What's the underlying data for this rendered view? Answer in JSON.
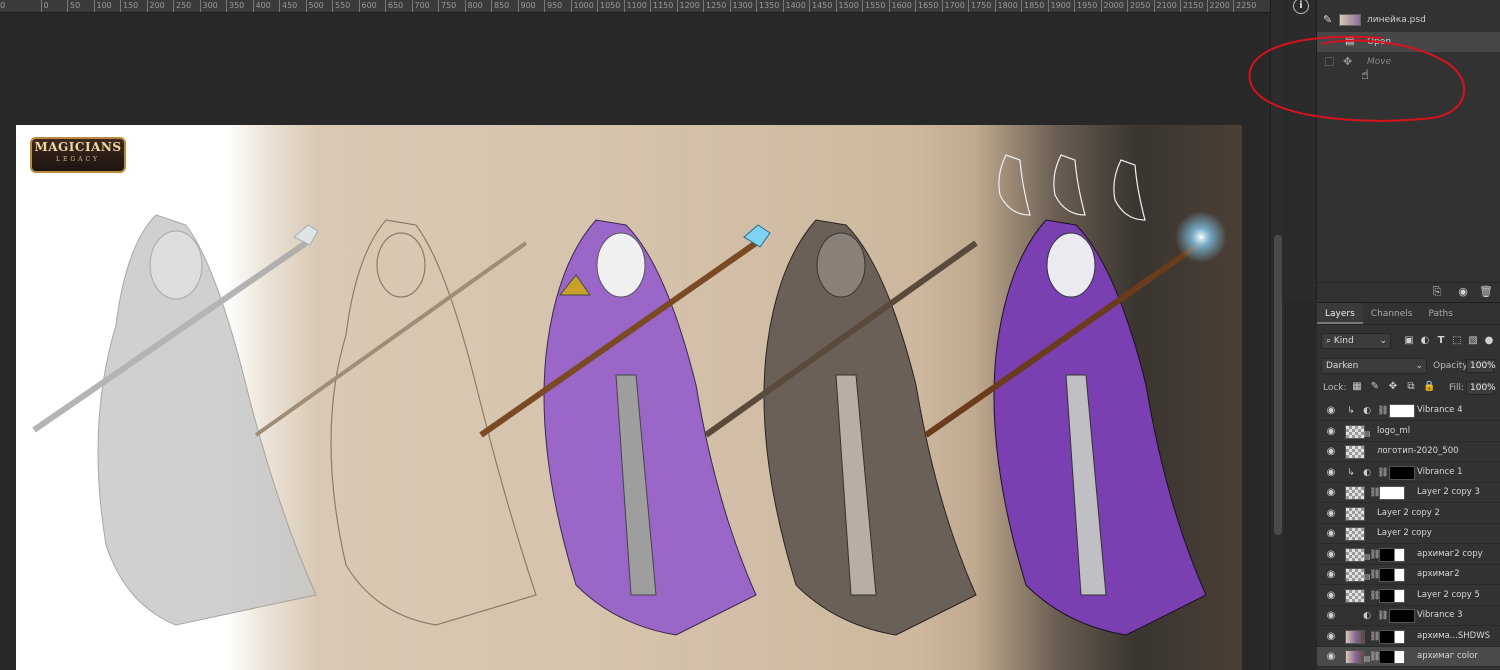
{
  "ruler": {
    "ticks": [
      "50",
      "0",
      "50",
      "100",
      "150",
      "200",
      "250",
      "300",
      "350",
      "400",
      "450",
      "500",
      "550",
      "600",
      "650",
      "700",
      "750",
      "800",
      "850",
      "900",
      "950",
      "1000",
      "1050",
      "1100",
      "1150",
      "1200",
      "1250",
      "1300",
      "1350",
      "1400",
      "1450",
      "1500",
      "1550",
      "1600",
      "1650",
      "1700",
      "1750",
      "1800",
      "1850",
      "1900",
      "1950",
      "2000",
      "2050",
      "2100",
      "2150",
      "2200",
      "2250"
    ]
  },
  "history": {
    "info_icon": "i",
    "items": [
      {
        "label": "линейка.psd",
        "icon": "brush-icon"
      },
      {
        "label": "Open",
        "icon": "document-icon"
      },
      {
        "label": "Move",
        "icon": "move-icon"
      }
    ]
  },
  "artboard": {
    "logo_line1": "MAGICIANS",
    "logo_line2": "LEGACY"
  },
  "layers_panel": {
    "tabs": [
      "Layers",
      "Channels",
      "Paths"
    ],
    "kind": "Kind",
    "blend_mode": "Darken",
    "opacity_label": "Opacity:",
    "opacity_value": "100%",
    "lock_label": "Lock:",
    "fill_label": "Fill:",
    "fill_value": "100%",
    "layers": [
      {
        "name": "Vibrance 4",
        "type": "adjustment",
        "mask": "white",
        "clipped": true
      },
      {
        "name": "logo_ml",
        "type": "smart",
        "thumb": "checker"
      },
      {
        "name": "логотип-2020_500",
        "type": "pixel",
        "thumb": "checker"
      },
      {
        "name": "Vibrance 1",
        "type": "adjustment",
        "mask": "black",
        "clipped": true
      },
      {
        "name": "Layer 2 copy 3",
        "type": "pixel",
        "thumb": "checker",
        "mask": "white"
      },
      {
        "name": "Layer 2 copy 2",
        "type": "pixel",
        "thumb": "checker"
      },
      {
        "name": "Layer 2 copy",
        "type": "pixel",
        "thumb": "checker"
      },
      {
        "name": "архимаг2 copy",
        "type": "smart",
        "thumb": "checker",
        "mask": "mask"
      },
      {
        "name": "архимаг2",
        "type": "smart",
        "thumb": "checker",
        "mask": "mask"
      },
      {
        "name": "Layer 2 copy 5",
        "type": "pixel",
        "thumb": "checker",
        "mask": "mask"
      },
      {
        "name": "Vibrance 3",
        "type": "adjustment",
        "mask": "black"
      },
      {
        "name": "архима...SHDWS",
        "type": "pixel",
        "thumb": "photo",
        "mask": "mask"
      },
      {
        "name": "архимаг color",
        "type": "smart",
        "thumb": "photo",
        "mask": "mask"
      }
    ]
  }
}
